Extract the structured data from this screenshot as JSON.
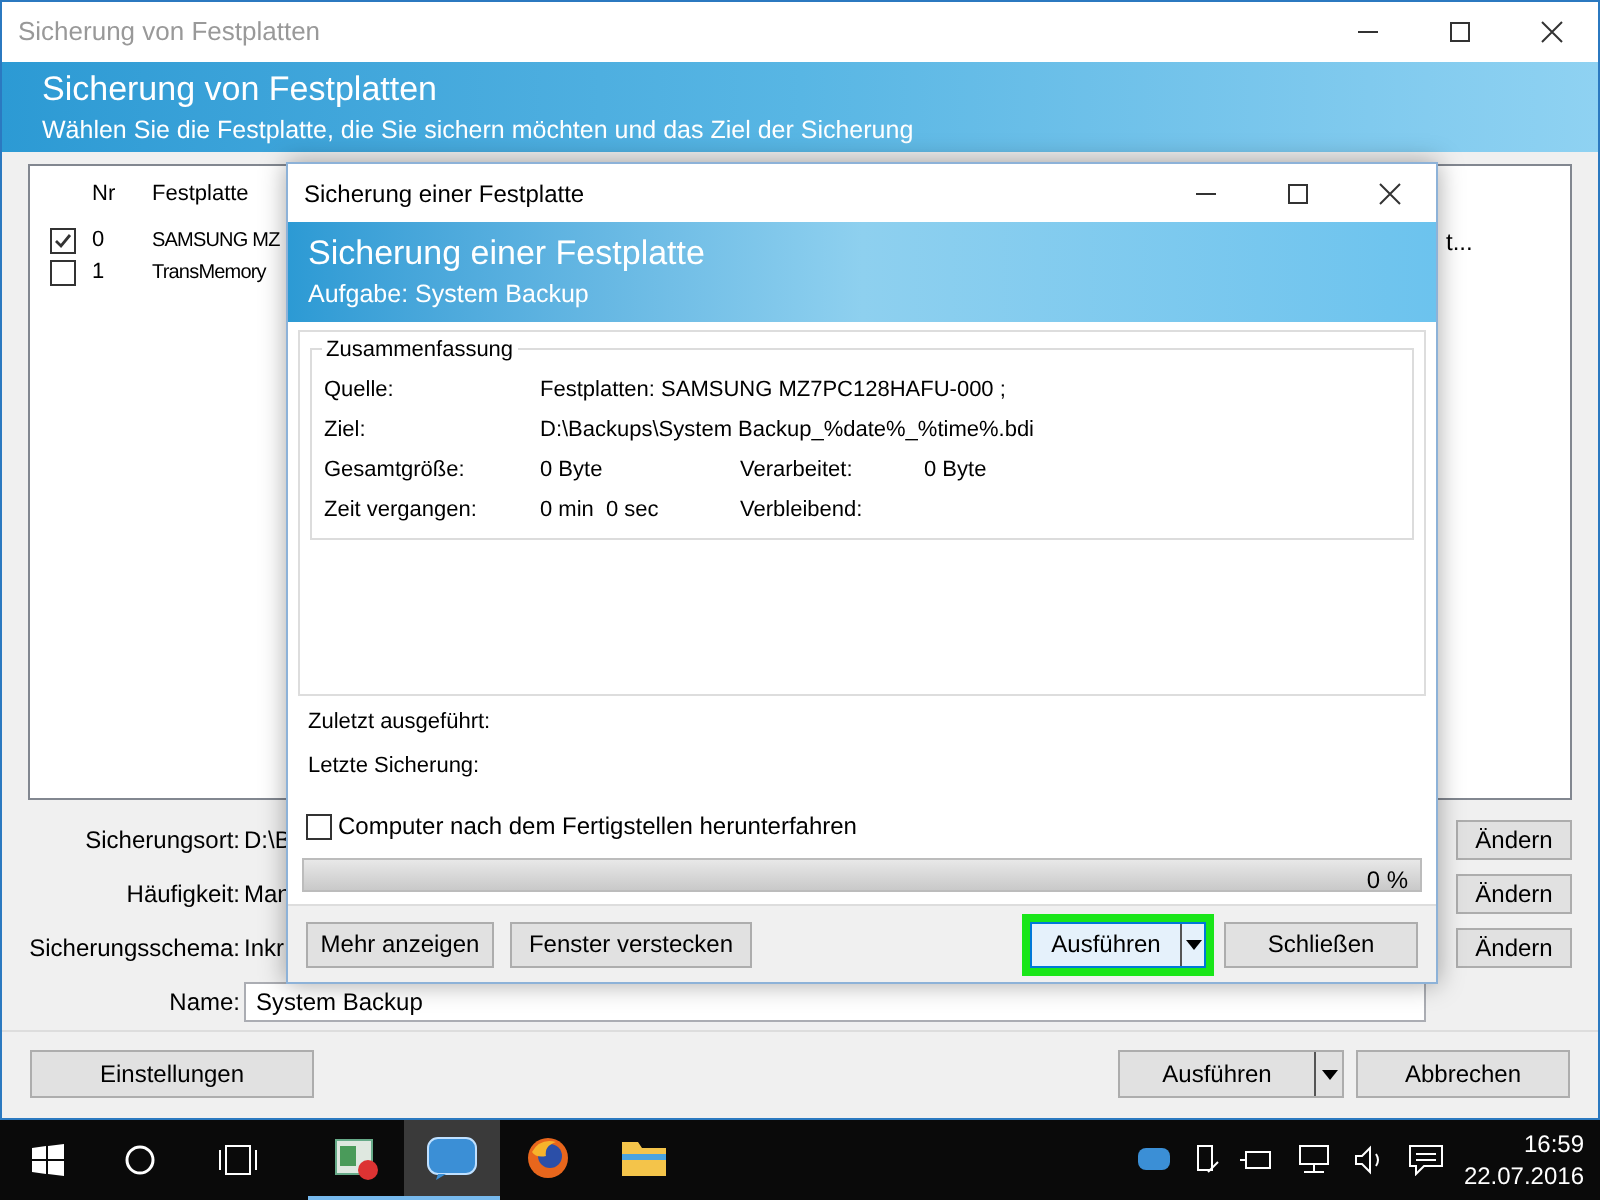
{
  "window": {
    "title": "Sicherung von Festplatten"
  },
  "header": {
    "title": "Sicherung von Festplatten",
    "subtitle": "Wählen Sie die Festplatte, die Sie sichern möchten und das Ziel der Sicherung"
  },
  "disk_table": {
    "columns": [
      "Nr",
      "Festplatte"
    ],
    "rows": [
      {
        "checked": true,
        "nr": "0",
        "disk": "SAMSUNG MZ",
        "column_3": "t..."
      },
      {
        "checked": false,
        "nr": "1",
        "disk": "TransMemory"
      }
    ]
  },
  "settings": [
    {
      "kind": "row",
      "label": "Sicherungsort:",
      "value": "D:\\B",
      "button": "Ändern"
    },
    {
      "kind": "row",
      "label": "Häufigkeit:",
      "value": "Man",
      "button": "Ändern"
    },
    {
      "kind": "row",
      "label": "Sicherungsschema:",
      "value": "Inkr",
      "button": "Ändern"
    },
    {
      "kind": "field",
      "label": "Name:",
      "value": "System Backup"
    }
  ],
  "footer": {
    "settings_button": "Einstellungen",
    "run_button": "Ausführen",
    "cancel_button": "Abbrechen"
  },
  "dialog": {
    "title": "Sicherung einer Festplatte",
    "header_title": "Sicherung einer Festplatte",
    "header_subtitle": "Aufgabe: System Backup",
    "summary": {
      "legend": "Zusammenfassung",
      "rows": [
        {
          "kind": "single",
          "label": "Quelle:",
          "value": "Festplatten: SAMSUNG MZ7PC128HAFU-000 ;"
        },
        {
          "kind": "single",
          "label": "Ziel:",
          "value": "D:\\Backups\\System Backup_%date%_%time%.bdi"
        },
        {
          "kind": "pair",
          "label": "Gesamtgröße:",
          "value": "0 Byte",
          "label_2": "Verarbeitet:",
          "value_2": "0 Byte"
        },
        {
          "kind": "pair",
          "label": "Zeit vergangen:",
          "value": "0 min  0 sec",
          "label_2": "Verbleibend:"
        }
      ]
    },
    "last_run_label": "Zuletzt ausgeführt:",
    "last_backup_label": "Letzte Sicherung:",
    "shutdown": {
      "label": "Computer nach dem Fertigstellen herunterfahren",
      "checked": false
    },
    "progress": {
      "level": 0,
      "reading": "0 %"
    },
    "buttons": {
      "more": "Mehr anzeigen",
      "hide": "Fenster verstecken",
      "run": "Ausführen",
      "run_highlighted": true,
      "close": "Schließen"
    }
  },
  "taskbar": {
    "apps": [
      {
        "kind": "window",
        "running": true,
        "selected": false
      },
      {
        "kind": "backup",
        "running": true,
        "selected": true
      },
      {
        "kind": "browser",
        "running": false,
        "selected": false
      },
      {
        "kind": "folder",
        "running": false,
        "selected": false
      }
    ],
    "time": "16:59",
    "date": "22.07.2016"
  }
}
